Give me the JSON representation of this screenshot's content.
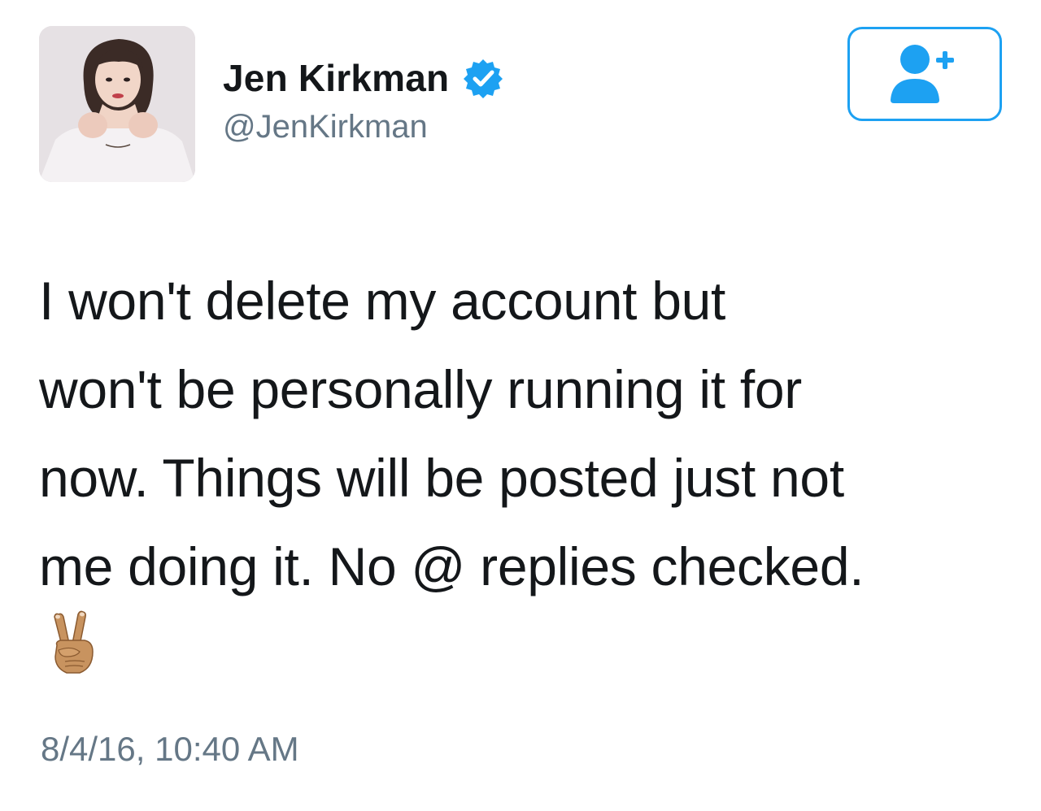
{
  "tweet": {
    "author": {
      "display_name": "Jen Kirkman",
      "handle": "@JenKirkman",
      "verified": true,
      "avatar_icon": "profile-photo"
    },
    "follow_button": {
      "icon": "add-user-icon"
    },
    "text_lines": [
      "I won't delete my account but",
      "won't be personally running it for",
      "now. Things will be posted just not",
      "me doing it. No @ replies checked."
    ],
    "emoji": "✌🏽",
    "timestamp": "8/4/16, 10:40 AM"
  },
  "colors": {
    "accent": "#1da1f2",
    "text_primary": "#14171a",
    "text_secondary": "#657786",
    "verified_badge": "#1da1f2"
  }
}
